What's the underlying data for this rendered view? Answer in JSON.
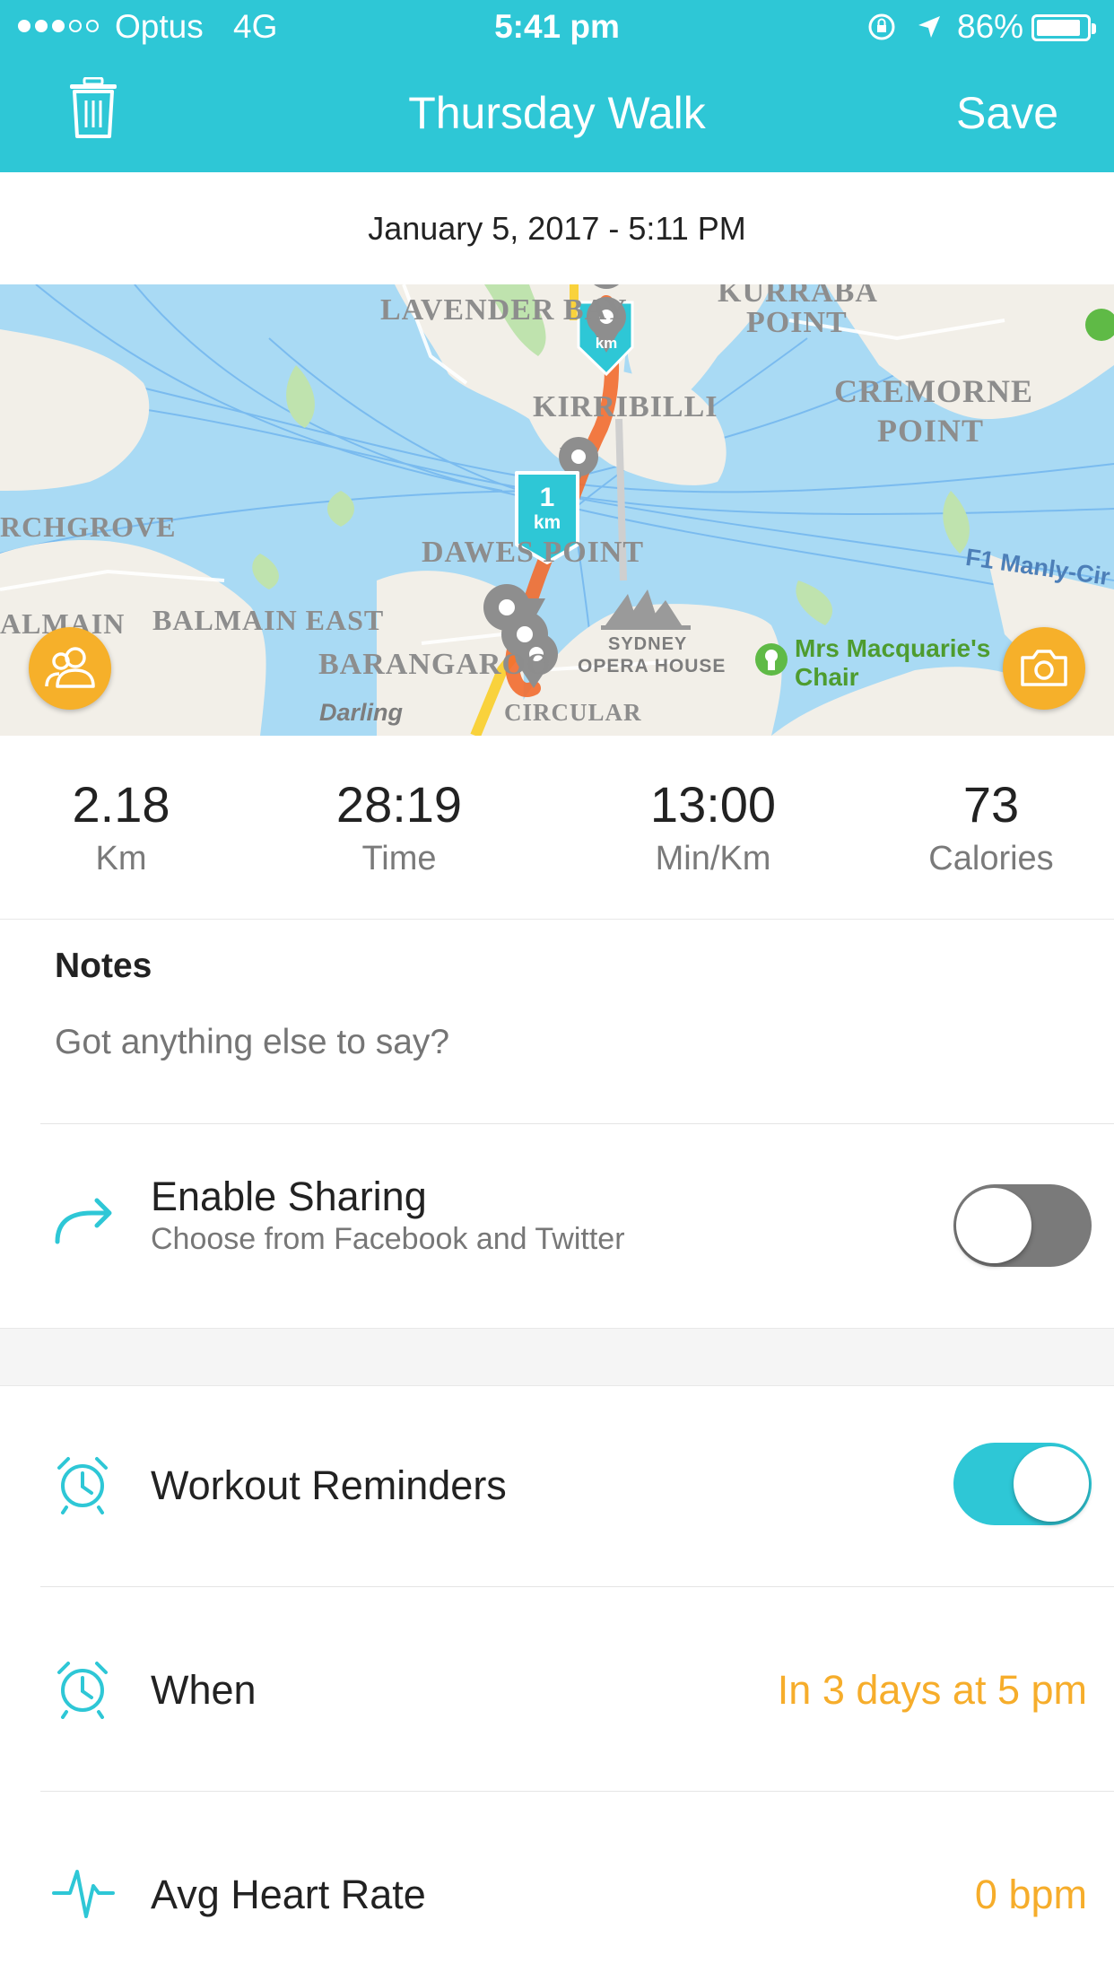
{
  "status_bar": {
    "carrier": "Optus",
    "network": "4G",
    "time": "5:41 pm",
    "battery": "86%"
  },
  "nav": {
    "title": "Thursday Walk",
    "save_label": "Save",
    "delete_icon": "trash-icon"
  },
  "workout": {
    "datetime": "January 5, 2017 - 5:11 PM"
  },
  "map": {
    "labels": {
      "lavender_bay": "LAVENDER BAY",
      "kurraba_point_1": "KURRABA",
      "kurraba_point_2": "POINT",
      "cremorne_1": "CREMORNE",
      "cremorne_2": "POINT",
      "kirribilli": "KIRRIBILLI",
      "birchgrove": "RCHGROVE",
      "dawes_point": "DAWES POINT",
      "manly": "F1 Manly-Cir",
      "balmain": "ALMAIN",
      "balmain_east": "BALMAIN EAST",
      "barangaroo": "BARANGAROO",
      "darling": "Darling",
      "opera_1": "SYDNEY",
      "opera_2": "OPERA HOUSE",
      "mrs_macquarie_1": "Mrs Macquarie's",
      "mrs_macquarie_2": "Chair",
      "circular_quay": "CIRCULAR",
      "km_marker_number": "1",
      "km_marker_unit": "km",
      "km_marker_top": "km"
    },
    "friends_icon": "friends-icon",
    "camera_icon": "camera-icon"
  },
  "stats": [
    {
      "value": "2.18",
      "label": "Km"
    },
    {
      "value": "28:19",
      "label": "Time"
    },
    {
      "value": "13:00",
      "label": "Min/Km"
    },
    {
      "value": "73",
      "label": "Calories"
    }
  ],
  "notes": {
    "label": "Notes",
    "placeholder": "Got anything else to say?"
  },
  "sharing": {
    "title": "Enable Sharing",
    "subtitle": "Choose from Facebook and Twitter",
    "enabled": false
  },
  "reminders": {
    "title": "Workout Reminders",
    "enabled": true
  },
  "when": {
    "title": "When",
    "value": "In 3 days at 5 pm"
  },
  "heart_rate": {
    "title": "Avg Heart Rate",
    "value": "0 bpm"
  },
  "colors": {
    "accent": "#2ec7d6",
    "orange": "#f6ad2b",
    "route": "#f26c2f"
  }
}
